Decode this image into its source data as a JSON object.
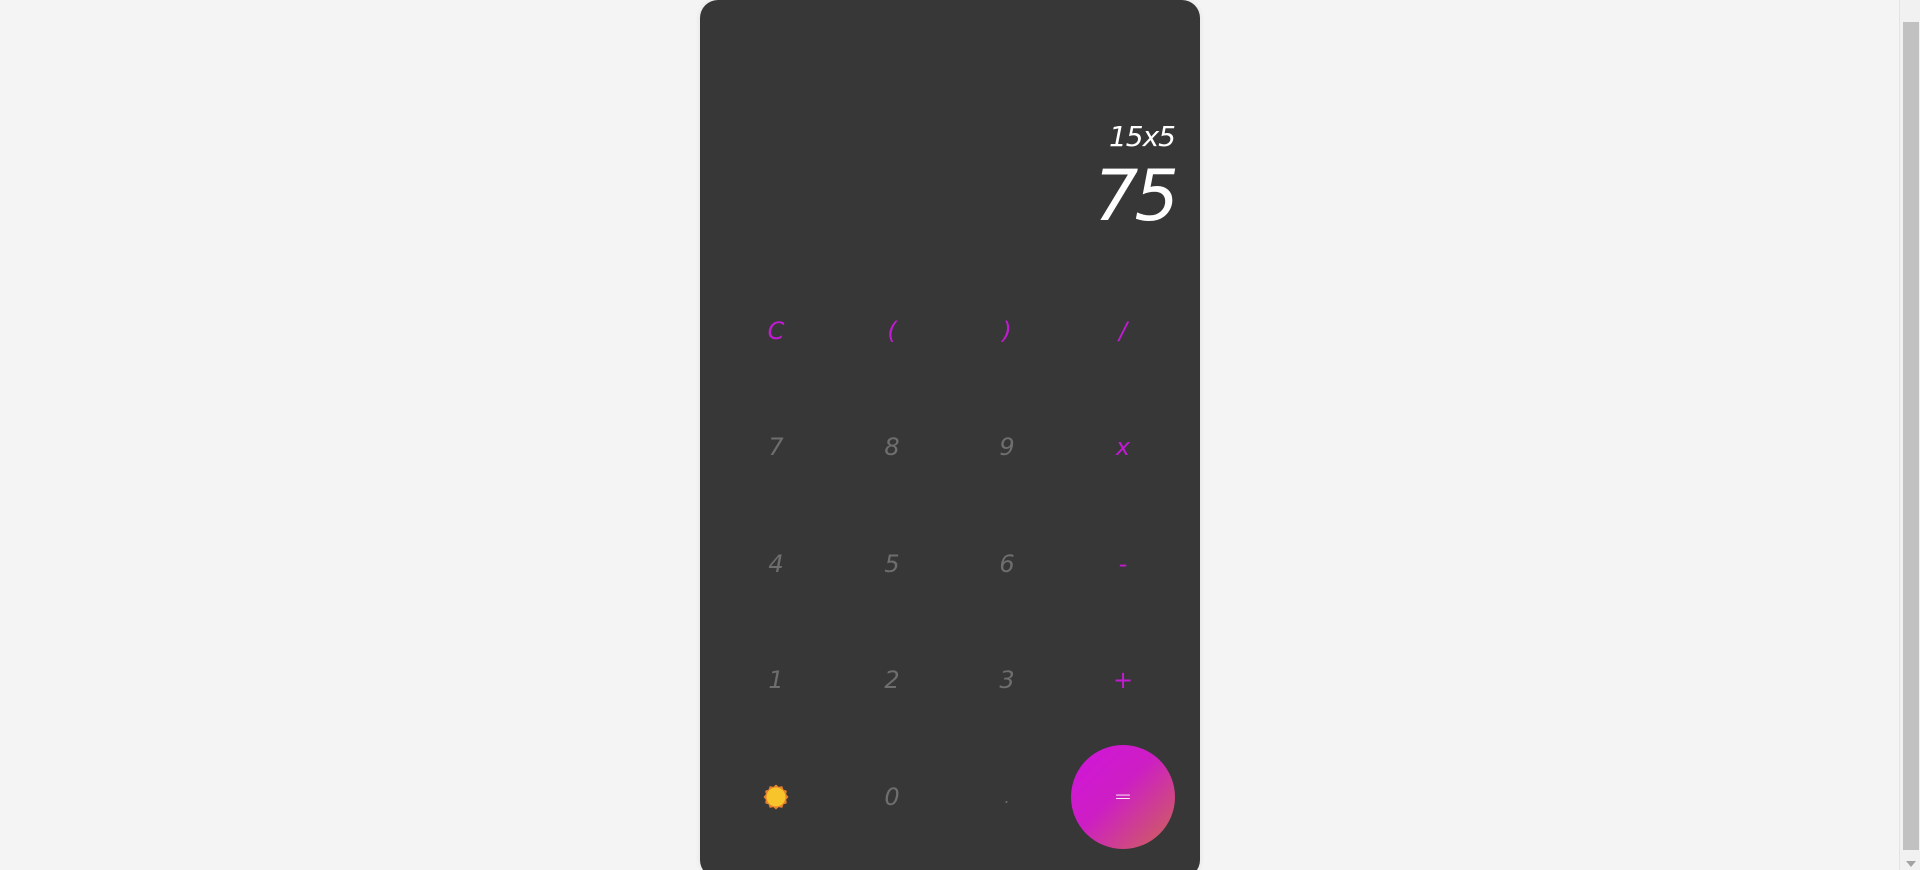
{
  "display": {
    "expression": "15x5",
    "result": "75"
  },
  "keys": [
    {
      "label": "C",
      "name": "clear-button",
      "type": "op"
    },
    {
      "label": "(",
      "name": "open-paren-button",
      "type": "op"
    },
    {
      "label": ")",
      "name": "close-paren-button",
      "type": "op"
    },
    {
      "label": "/",
      "name": "divide-button",
      "type": "op"
    },
    {
      "label": "7",
      "name": "digit-7-button",
      "type": "digit"
    },
    {
      "label": "8",
      "name": "digit-8-button",
      "type": "digit"
    },
    {
      "label": "9",
      "name": "digit-9-button",
      "type": "digit"
    },
    {
      "label": "x",
      "name": "multiply-button",
      "type": "op"
    },
    {
      "label": "4",
      "name": "digit-4-button",
      "type": "digit"
    },
    {
      "label": "5",
      "name": "digit-5-button",
      "type": "digit"
    },
    {
      "label": "6",
      "name": "digit-6-button",
      "type": "digit"
    },
    {
      "label": "-",
      "name": "subtract-button",
      "type": "op"
    },
    {
      "label": "1",
      "name": "digit-1-button",
      "type": "digit"
    },
    {
      "label": "2",
      "name": "digit-2-button",
      "type": "digit"
    },
    {
      "label": "3",
      "name": "digit-3-button",
      "type": "digit"
    },
    {
      "label": "+",
      "name": "add-button",
      "type": "op"
    },
    {
      "label": "",
      "name": "theme-toggle-button",
      "type": "theme",
      "icon": "sun-icon"
    },
    {
      "label": "0",
      "name": "digit-0-button",
      "type": "digit"
    },
    {
      "label": ".",
      "name": "decimal-button",
      "type": "digit"
    },
    {
      "label": "=",
      "name": "equals-button",
      "type": "equals"
    }
  ],
  "colors": {
    "background": "#f4f4f4",
    "calculator": "#373737",
    "operator": "#c21ad2",
    "digit": "#6e6e6e",
    "equals_gradient_start": "#d115db",
    "equals_gradient_end": "#cf6653",
    "sun": "#f7c52b"
  }
}
